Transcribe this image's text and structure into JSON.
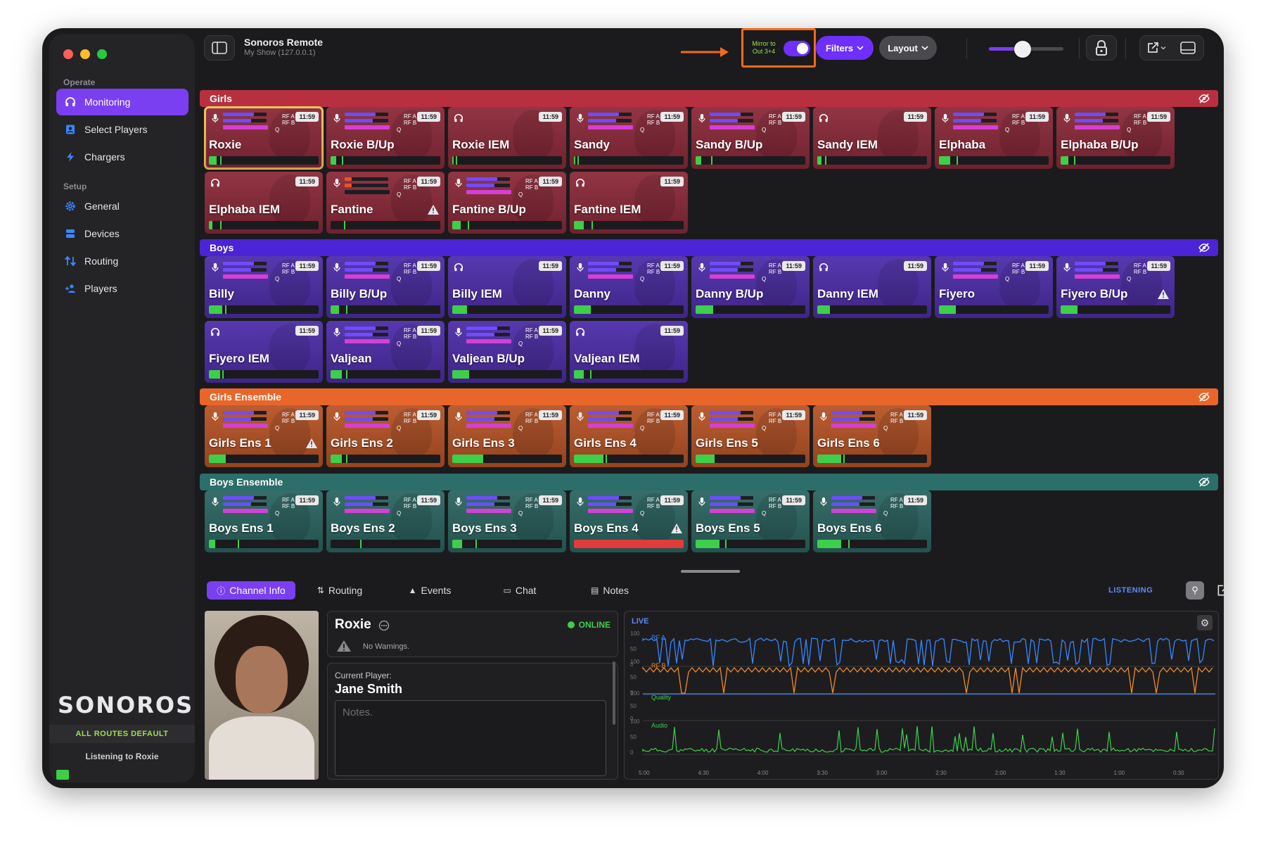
{
  "window": {
    "app_title": "Sonoros Remote",
    "subtitle": "My Show (127.0.0.1)"
  },
  "toolbar": {
    "mirror_label": "Mirror to\nOut 3+4",
    "mirror_on": true,
    "filters_label": "Filters",
    "layout_label": "Layout",
    "volume_level": 0.45,
    "accent_color": "#7b3ff2",
    "highlight_color": "#f26a1b"
  },
  "sidebar": {
    "operate_label": "Operate",
    "setup_label": "Setup",
    "operate_items": [
      {
        "label": "Monitoring",
        "icon": "headphones-icon",
        "active": true
      },
      {
        "label": "Select Players",
        "icon": "person-card-icon",
        "active": false
      },
      {
        "label": "Chargers",
        "icon": "bolt-icon",
        "active": false
      }
    ],
    "setup_items": [
      {
        "label": "General",
        "icon": "gear-icon"
      },
      {
        "label": "Devices",
        "icon": "devices-icon"
      },
      {
        "label": "Routing",
        "icon": "routing-icon"
      },
      {
        "label": "Players",
        "icon": "people-icon"
      }
    ],
    "logo": "SONOROS",
    "routes_status": "ALL ROUTES DEFAULT",
    "listening_to": "Listening to Roxie"
  },
  "groups": [
    {
      "name": "Girls",
      "color": "#b8303f",
      "tile_color": "#8c2a3a",
      "tiles": [
        {
          "name": "Roxie",
          "kind": "mic",
          "selected": true,
          "warn": false,
          "level": 0.07,
          "peak": 0.1
        },
        {
          "name": "Roxie B/Up",
          "kind": "mic",
          "warn": false,
          "level": 0.05,
          "peak": 0.1
        },
        {
          "name": "Roxie IEM",
          "kind": "iem",
          "warn": false,
          "level": 0.01,
          "peak": 0.03
        },
        {
          "name": "Sandy",
          "kind": "mic",
          "warn": false,
          "level": 0.01,
          "peak": 0.03
        },
        {
          "name": "Sandy B/Up",
          "kind": "mic",
          "warn": false,
          "level": 0.05,
          "peak": 0.14
        },
        {
          "name": "Sandy IEM",
          "kind": "iem",
          "warn": false,
          "level": 0.04,
          "peak": 0.07
        },
        {
          "name": "Elphaba",
          "kind": "mic",
          "warn": false,
          "level": 0.1,
          "peak": 0.16
        },
        {
          "name": "Elphaba B/Up",
          "kind": "mic",
          "warn": false,
          "level": 0.07,
          "peak": 0.12
        },
        {
          "name": "Elphaba IEM",
          "kind": "iem",
          "warn": false,
          "level": 0.03,
          "peak": 0.1
        },
        {
          "name": "Fantine",
          "kind": "mic",
          "warn": true,
          "level": 0.0,
          "peak": 0.12
        },
        {
          "name": "Fantine B/Up",
          "kind": "mic",
          "warn": false,
          "level": 0.08,
          "peak": 0.14
        },
        {
          "name": "Fantine IEM",
          "kind": "iem",
          "warn": false,
          "level": 0.09,
          "peak": 0.16
        }
      ]
    },
    {
      "name": "Boys",
      "color": "#4a24d6",
      "tile_color": "#4e2eaa",
      "tiles": [
        {
          "name": "Billy",
          "kind": "mic",
          "warn": false,
          "level": 0.12,
          "peak": 0.15
        },
        {
          "name": "Billy B/Up",
          "kind": "mic",
          "warn": false,
          "level": 0.08,
          "peak": 0.14
        },
        {
          "name": "Billy IEM",
          "kind": "iem",
          "warn": false,
          "level": 0.12,
          "peak": 0.12
        },
        {
          "name": "Danny",
          "kind": "mic",
          "warn": false,
          "level": 0.14,
          "peak": 0.14
        },
        {
          "name": "Danny B/Up",
          "kind": "mic",
          "warn": false,
          "level": 0.15,
          "peak": 0.15
        },
        {
          "name": "Danny IEM",
          "kind": "iem",
          "warn": false,
          "level": 0.1,
          "peak": 0.1
        },
        {
          "name": "Fiyero",
          "kind": "mic",
          "warn": false,
          "level": 0.14,
          "peak": 0.14
        },
        {
          "name": "Fiyero B/Up",
          "kind": "mic",
          "warn": true,
          "level": 0.14,
          "peak": 0.14
        },
        {
          "name": "Fiyero IEM",
          "kind": "iem",
          "warn": false,
          "level": 0.1,
          "peak": 0.12
        },
        {
          "name": "Valjean",
          "kind": "mic",
          "warn": false,
          "level": 0.1,
          "peak": 0.14
        },
        {
          "name": "Valjean B/Up",
          "kind": "mic",
          "warn": false,
          "level": 0.14,
          "peak": 0.14
        },
        {
          "name": "Valjean IEM",
          "kind": "iem",
          "warn": false,
          "level": 0.09,
          "peak": 0.15
        }
      ]
    },
    {
      "name": "Girls Ensemble",
      "color": "#e8662a",
      "tile_color": "#b85426",
      "tiles": [
        {
          "name": "Girls Ens 1",
          "kind": "mic",
          "warn": true,
          "level": 0.14,
          "peak": 0.14
        },
        {
          "name": "Girls Ens 2",
          "kind": "mic",
          "warn": false,
          "level": 0.1,
          "peak": 0.14
        },
        {
          "name": "Girls Ens 3",
          "kind": "mic",
          "warn": false,
          "level": 0.27,
          "peak": 0.27
        },
        {
          "name": "Girls Ens 4",
          "kind": "mic",
          "warn": false,
          "level": 0.27,
          "peak": 0.29
        },
        {
          "name": "Girls Ens 5",
          "kind": "mic",
          "warn": false,
          "level": 0.16,
          "peak": 0.16
        },
        {
          "name": "Girls Ens 6",
          "kind": "mic",
          "warn": false,
          "level": 0.22,
          "peak": 0.24
        }
      ]
    },
    {
      "name": "Boys Ensemble",
      "color": "#2b6e6a",
      "tile_color": "#2c6662",
      "tiles": [
        {
          "name": "Boys Ens 1",
          "kind": "mic",
          "warn": false,
          "level": 0.06,
          "peak": 0.26
        },
        {
          "name": "Boys Ens 2",
          "kind": "mic",
          "warn": false,
          "level": 0.0,
          "peak": 0.27
        },
        {
          "name": "Boys Ens 3",
          "kind": "mic",
          "warn": false,
          "level": 0.09,
          "peak": 0.21
        },
        {
          "name": "Boys Ens 4",
          "kind": "mic",
          "warn": true,
          "level": 1.0,
          "peak": 1.0,
          "alert": true
        },
        {
          "name": "Boys Ens 5",
          "kind": "mic",
          "warn": false,
          "level": 0.22,
          "peak": 0.27
        },
        {
          "name": "Boys Ens 6",
          "kind": "mic",
          "warn": false,
          "level": 0.22,
          "peak": 0.28
        }
      ]
    }
  ],
  "tile_text": {
    "time": "11:59",
    "rf_a": "RF A",
    "rf_b": "RF B",
    "q": "Q"
  },
  "tabs": [
    {
      "label": "Channel Info",
      "icon": "info-icon",
      "active": true
    },
    {
      "label": "Routing",
      "icon": "routing-icon"
    },
    {
      "label": "Events",
      "icon": "warning-icon"
    },
    {
      "label": "Chat",
      "icon": "chat-icon"
    },
    {
      "label": "Notes",
      "icon": "notes-icon"
    }
  ],
  "detail": {
    "listening_badge": "LISTENING",
    "channel_name": "Roxie",
    "status": "ONLINE",
    "warnings": "No Warnings.",
    "current_player_label": "Current Player:",
    "current_player": "Jane Smith",
    "notes_placeholder": "Notes."
  },
  "chart_data": {
    "type": "line",
    "title": "LIVE",
    "x_ticks": [
      "5:00",
      "4:30",
      "4:00",
      "3:30",
      "3:00",
      "2:30",
      "2:00",
      "1:30",
      "1:00",
      "0:30"
    ],
    "y_ticks": [
      "100",
      "50",
      "0"
    ],
    "series": [
      {
        "name": "RF A",
        "color": "#3a86ff",
        "baseline": 85,
        "spike_count": 40
      },
      {
        "name": "RF B",
        "color": "#f08a24",
        "baseline": 80,
        "spike_count": 9
      },
      {
        "name": "Quality",
        "color": "#3ecf4a",
        "baseline": 0
      },
      {
        "name": "Audio",
        "color": "#3ecf4a",
        "baseline": 10,
        "spike_count": 30
      }
    ]
  }
}
